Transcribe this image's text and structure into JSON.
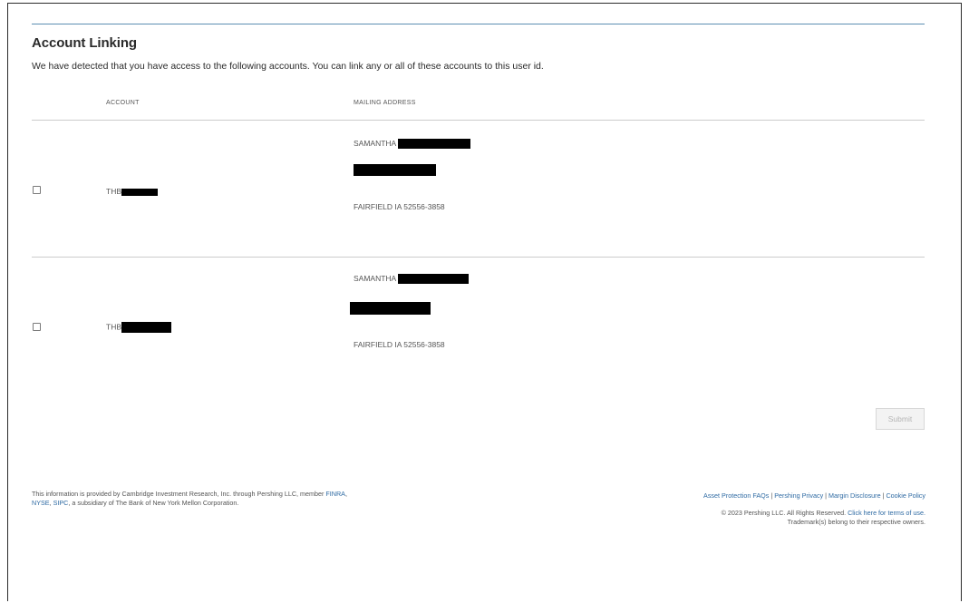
{
  "page": {
    "title": "Account Linking",
    "intro": "We have detected that you have access to the following accounts. You can link any or all of these accounts to this user id."
  },
  "table": {
    "headers": {
      "account": "ACCOUNT",
      "mailing_address": "MAILING ADDRESS"
    },
    "rows": [
      {
        "account_prefix": "THB",
        "name_prefix": "SAMANTHA",
        "city_line": "FAIRFIELD IA 52556-3858",
        "checked": false
      },
      {
        "account_prefix": "THB",
        "name_prefix": "SAMANTHA",
        "city_line": "FAIRFIELD IA 52556-3858",
        "checked": false
      }
    ]
  },
  "actions": {
    "submit_label": "Submit",
    "submit_disabled": true
  },
  "footer": {
    "left_text_1": "This information is provided by Cambridge Investment Research, Inc. through Pershing LLC, member ",
    "link_finra": "FINRA",
    "comma": ",",
    "link_nyse": "NYSE",
    "comma_space": ", ",
    "link_sipc": "SIPC",
    "left_text_2": ", a subsidiary of The Bank of New York Mellon Corporation.",
    "links": {
      "asset_protection": "Asset Protection FAQs",
      "pershing_privacy": "Pershing Privacy",
      "margin_disclosure": "Margin Disclosure",
      "cookie_policy": "Cookie Policy",
      "separator": "|"
    },
    "copyright": "© 2023 Pershing LLC. All Rights Reserved.",
    "terms_link": "Click here for terms of use.",
    "trademarks": "Trademark(s) belong to their respective owners."
  },
  "colors": {
    "link": "#2e6aa3",
    "top_rule": "#5c8fb3",
    "redaction": "#000000",
    "submit_disabled_text": "#b5b5b5"
  }
}
